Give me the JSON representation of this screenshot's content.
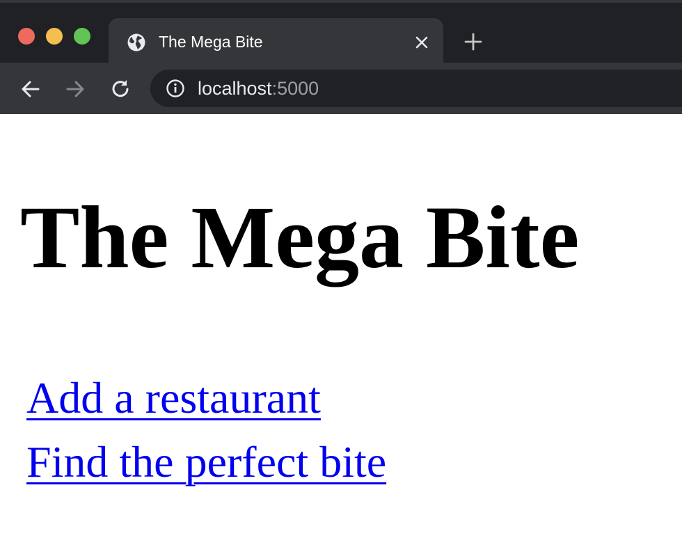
{
  "browser": {
    "tab": {
      "title": "The Mega Bite",
      "favicon": "globe-icon",
      "close_icon": "close-icon"
    },
    "new_tab_icon": "plus-icon",
    "toolbar": {
      "back_icon": "arrow-left-icon",
      "forward_icon": "arrow-right-icon",
      "reload_icon": "reload-icon",
      "site_info_icon": "info-icon"
    },
    "address": {
      "host": "localhost",
      "port": ":5000"
    },
    "colors": {
      "tabstrip": "#202124",
      "toolbar": "#35363a",
      "close_dot": "#ed6a5e",
      "minimize_dot": "#f5bf4f",
      "maximize_dot": "#61c554"
    }
  },
  "page": {
    "title": "The Mega Bite",
    "links": [
      {
        "label": "Add a restaurant"
      },
      {
        "label": "Find the perfect bite"
      }
    ],
    "link_color": "#0000ee"
  }
}
